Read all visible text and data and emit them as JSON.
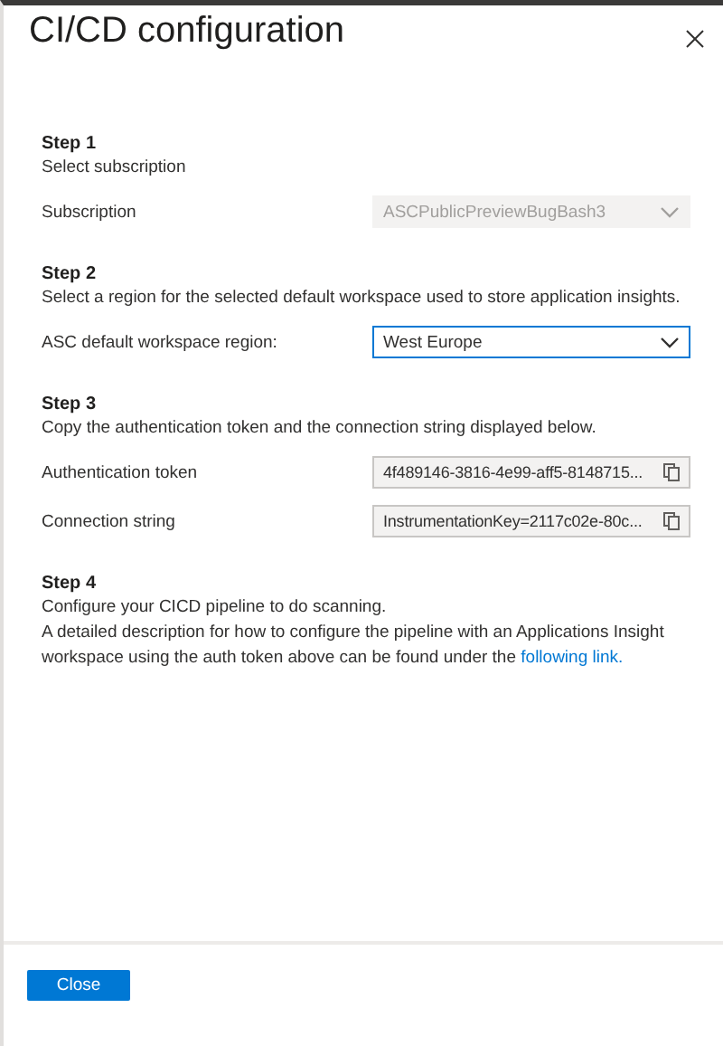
{
  "title": "CI/CD configuration",
  "steps": [
    {
      "title": "Step 1",
      "lines": [
        "Select subscription"
      ],
      "fields": [
        {
          "kind": "dropdown",
          "label": "Subscription",
          "value": "ASCPublicPreviewBugBash3",
          "disabled": true
        }
      ]
    },
    {
      "title": "Step 2",
      "lines": [
        "Select a region for the selected default workspace used to store application insights."
      ],
      "fields": [
        {
          "kind": "dropdown",
          "label": "ASC default workspace region:",
          "value": "West Europe",
          "disabled": false
        }
      ]
    },
    {
      "title": "Step 3",
      "lines": [
        "Copy the authentication token and the connection string displayed below."
      ],
      "fields": [
        {
          "kind": "copy",
          "label": "Authentication token",
          "value": "4f489146-3816-4e99-aff5-8148715..."
        },
        {
          "kind": "copy",
          "label": "Connection string",
          "value": "InstrumentationKey=2117c02e-80c..."
        }
      ]
    },
    {
      "title": "Step 4",
      "lines": [
        "Configure your CICD pipeline to do scanning."
      ],
      "paragraph": {
        "text": "A detailed description for how to configure the pipeline with an Applications Insight workspace using the auth token above can be found under the",
        "link": "following link."
      }
    }
  ],
  "buttons": [
    {
      "label": "Close"
    }
  ]
}
